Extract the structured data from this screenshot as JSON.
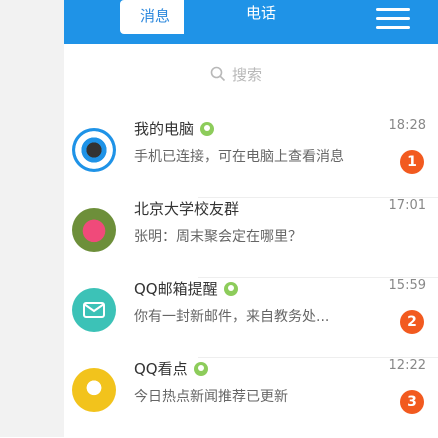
{
  "tabs": {
    "left_label": "消息",
    "right_label": "电话"
  },
  "search": {
    "placeholder": "搜索"
  },
  "contacts": [
    {
      "name": "我的电脑",
      "preview": "手机已连接，可在电脑上查看消息",
      "time": "18:28",
      "badge": "1"
    },
    {
      "name": "北京大学校友群",
      "preview": "张明：周末聚会定在哪里？",
      "time": "17:01",
      "badge": ""
    },
    {
      "name": "QQ邮箱提醒",
      "preview": "你有一封新邮件，来自教务处...",
      "time": "15:59",
      "badge": "2"
    },
    {
      "name": "QQ看点",
      "preview": "今日热点新闻推荐已更新",
      "time": "12:22",
      "badge": "3"
    }
  ],
  "colors": {
    "accent": "#1f93e7",
    "badge": "#f25a1f",
    "online": "#8dcc5b"
  }
}
